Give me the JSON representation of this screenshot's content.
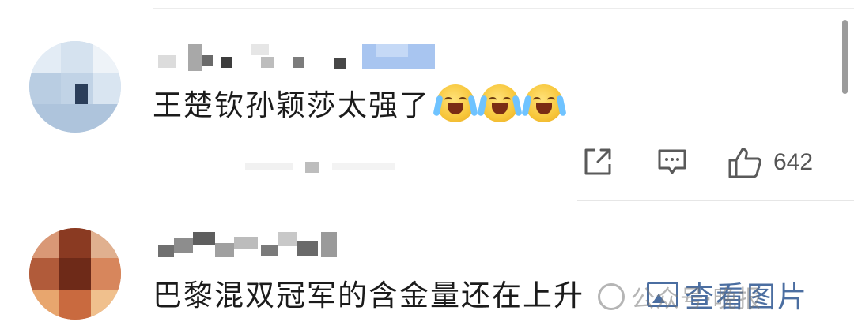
{
  "comments": [
    {
      "text": "王楚钦孙颖莎太强了",
      "emojis": [
        "laugh-cry-emoji",
        "laugh-cry-emoji",
        "laugh-cry-emoji"
      ],
      "actions": {
        "share_icon": "share-icon",
        "reply_icon": "comment-icon",
        "like_icon": "thumbs-up-icon",
        "like_count": "642"
      }
    },
    {
      "text": "巴黎混双冠军的含金量还在上升",
      "view_image_label": "查看图片"
    }
  ],
  "watermark": {
    "text": "公众号·晚报"
  },
  "colors": {
    "link": "#4b6ea1",
    "text": "#1b1b1b",
    "icon": "#5a5a5a"
  }
}
